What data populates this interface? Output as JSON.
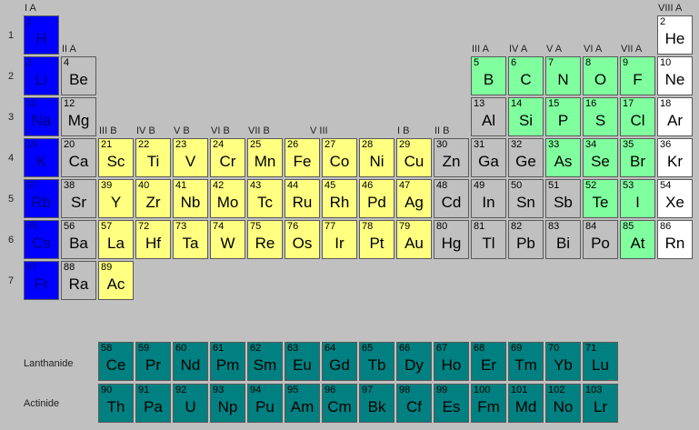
{
  "colors": {
    "s": "#0000ff",
    "nm": "#80ff9f",
    "tm": "#ffff80",
    "pm": "#c0c0c0",
    "ng": "#ffffff",
    "ln": "#008080",
    "gray": "#c0c0c0"
  },
  "groups": [
    {
      "label": "I A",
      "col": 1
    },
    {
      "label": "II A",
      "col": 2
    },
    {
      "label": "III B",
      "col": 3
    },
    {
      "label": "IV B",
      "col": 4
    },
    {
      "label": "V B",
      "col": 5
    },
    {
      "label": "VI B",
      "col": 6
    },
    {
      "label": "VII B",
      "col": 7
    },
    {
      "label": "V III",
      "col": 9
    },
    {
      "label": "I B",
      "col": 11
    },
    {
      "label": "II B",
      "col": 12
    },
    {
      "label": "III A",
      "col": 13
    },
    {
      "label": "IV A",
      "col": 14
    },
    {
      "label": "V A",
      "col": 15
    },
    {
      "label": "VI A",
      "col": 16
    },
    {
      "label": "VII A",
      "col": 17
    },
    {
      "label": "VIII A",
      "col": 18
    }
  ],
  "periods": [
    "1",
    "2",
    "3",
    "4",
    "5",
    "6",
    "7"
  ],
  "series_labels": {
    "lanthanide": "Lanthanide",
    "actinide": "Actinide"
  },
  "elements": [
    {
      "n": "1",
      "s": "H",
      "r": 1,
      "c": 1,
      "t": "s"
    },
    {
      "n": "2",
      "s": "He",
      "r": 1,
      "c": 18,
      "t": "ng"
    },
    {
      "n": "3",
      "s": "Li",
      "r": 2,
      "c": 1,
      "t": "s"
    },
    {
      "n": "4",
      "s": "Be",
      "r": 2,
      "c": 2,
      "t": "gray"
    },
    {
      "n": "5",
      "s": "B",
      "r": 2,
      "c": 13,
      "t": "nm"
    },
    {
      "n": "6",
      "s": "C",
      "r": 2,
      "c": 14,
      "t": "nm"
    },
    {
      "n": "7",
      "s": "N",
      "r": 2,
      "c": 15,
      "t": "nm"
    },
    {
      "n": "8",
      "s": "O",
      "r": 2,
      "c": 16,
      "t": "nm"
    },
    {
      "n": "9",
      "s": "F",
      "r": 2,
      "c": 17,
      "t": "nm"
    },
    {
      "n": "10",
      "s": "Ne",
      "r": 2,
      "c": 18,
      "t": "ng"
    },
    {
      "n": "11",
      "s": "Na",
      "r": 3,
      "c": 1,
      "t": "s"
    },
    {
      "n": "12",
      "s": "Mg",
      "r": 3,
      "c": 2,
      "t": "gray"
    },
    {
      "n": "13",
      "s": "Al",
      "r": 3,
      "c": 13,
      "t": "pm"
    },
    {
      "n": "14",
      "s": "Si",
      "r": 3,
      "c": 14,
      "t": "nm"
    },
    {
      "n": "15",
      "s": "P",
      "r": 3,
      "c": 15,
      "t": "nm"
    },
    {
      "n": "16",
      "s": "S",
      "r": 3,
      "c": 16,
      "t": "nm"
    },
    {
      "n": "17",
      "s": "Cl",
      "r": 3,
      "c": 17,
      "t": "nm"
    },
    {
      "n": "18",
      "s": "Ar",
      "r": 3,
      "c": 18,
      "t": "ng"
    },
    {
      "n": "19",
      "s": "K",
      "r": 4,
      "c": 1,
      "t": "s"
    },
    {
      "n": "20",
      "s": "Ca",
      "r": 4,
      "c": 2,
      "t": "gray"
    },
    {
      "n": "21",
      "s": "Sc",
      "r": 4,
      "c": 3,
      "t": "tm"
    },
    {
      "n": "22",
      "s": "Ti",
      "r": 4,
      "c": 4,
      "t": "tm"
    },
    {
      "n": "23",
      "s": "V",
      "r": 4,
      "c": 5,
      "t": "tm"
    },
    {
      "n": "24",
      "s": "Cr",
      "r": 4,
      "c": 6,
      "t": "tm"
    },
    {
      "n": "25",
      "s": "Mn",
      "r": 4,
      "c": 7,
      "t": "tm"
    },
    {
      "n": "26",
      "s": "Fe",
      "r": 4,
      "c": 8,
      "t": "tm"
    },
    {
      "n": "27",
      "s": "Co",
      "r": 4,
      "c": 9,
      "t": "tm"
    },
    {
      "n": "28",
      "s": "Ni",
      "r": 4,
      "c": 10,
      "t": "tm"
    },
    {
      "n": "29",
      "s": "Cu",
      "r": 4,
      "c": 11,
      "t": "tm"
    },
    {
      "n": "30",
      "s": "Zn",
      "r": 4,
      "c": 12,
      "t": "pm"
    },
    {
      "n": "31",
      "s": "Ga",
      "r": 4,
      "c": 13,
      "t": "pm"
    },
    {
      "n": "32",
      "s": "Ge",
      "r": 4,
      "c": 14,
      "t": "pm"
    },
    {
      "n": "33",
      "s": "As",
      "r": 4,
      "c": 15,
      "t": "nm"
    },
    {
      "n": "34",
      "s": "Se",
      "r": 4,
      "c": 16,
      "t": "nm"
    },
    {
      "n": "35",
      "s": "Br",
      "r": 4,
      "c": 17,
      "t": "nm"
    },
    {
      "n": "36",
      "s": "Kr",
      "r": 4,
      "c": 18,
      "t": "ng"
    },
    {
      "n": "37",
      "s": "Rb",
      "r": 5,
      "c": 1,
      "t": "s"
    },
    {
      "n": "38",
      "s": "Sr",
      "r": 5,
      "c": 2,
      "t": "gray"
    },
    {
      "n": "39",
      "s": "Y",
      "r": 5,
      "c": 3,
      "t": "tm"
    },
    {
      "n": "40",
      "s": "Zr",
      "r": 5,
      "c": 4,
      "t": "tm"
    },
    {
      "n": "41",
      "s": "Nb",
      "r": 5,
      "c": 5,
      "t": "tm"
    },
    {
      "n": "42",
      "s": "Mo",
      "r": 5,
      "c": 6,
      "t": "tm"
    },
    {
      "n": "43",
      "s": "Tc",
      "r": 5,
      "c": 7,
      "t": "tm"
    },
    {
      "n": "44",
      "s": "Ru",
      "r": 5,
      "c": 8,
      "t": "tm"
    },
    {
      "n": "45",
      "s": "Rh",
      "r": 5,
      "c": 9,
      "t": "tm"
    },
    {
      "n": "46",
      "s": "Pd",
      "r": 5,
      "c": 10,
      "t": "tm"
    },
    {
      "n": "47",
      "s": "Ag",
      "r": 5,
      "c": 11,
      "t": "tm"
    },
    {
      "n": "48",
      "s": "Cd",
      "r": 5,
      "c": 12,
      "t": "pm"
    },
    {
      "n": "49",
      "s": "In",
      "r": 5,
      "c": 13,
      "t": "pm"
    },
    {
      "n": "50",
      "s": "Sn",
      "r": 5,
      "c": 14,
      "t": "pm"
    },
    {
      "n": "51",
      "s": "Sb",
      "r": 5,
      "c": 15,
      "t": "pm"
    },
    {
      "n": "52",
      "s": "Te",
      "r": 5,
      "c": 16,
      "t": "nm"
    },
    {
      "n": "53",
      "s": "I",
      "r": 5,
      "c": 17,
      "t": "nm"
    },
    {
      "n": "54",
      "s": "Xe",
      "r": 5,
      "c": 18,
      "t": "ng"
    },
    {
      "n": "55",
      "s": "Cs",
      "r": 6,
      "c": 1,
      "t": "s"
    },
    {
      "n": "56",
      "s": "Ba",
      "r": 6,
      "c": 2,
      "t": "gray"
    },
    {
      "n": "57",
      "s": "La",
      "r": 6,
      "c": 3,
      "t": "tm"
    },
    {
      "n": "72",
      "s": "Hf",
      "r": 6,
      "c": 4,
      "t": "tm"
    },
    {
      "n": "73",
      "s": "Ta",
      "r": 6,
      "c": 5,
      "t": "tm"
    },
    {
      "n": "74",
      "s": "W",
      "r": 6,
      "c": 6,
      "t": "tm"
    },
    {
      "n": "75",
      "s": "Re",
      "r": 6,
      "c": 7,
      "t": "tm"
    },
    {
      "n": "76",
      "s": "Os",
      "r": 6,
      "c": 8,
      "t": "tm"
    },
    {
      "n": "77",
      "s": "Ir",
      "r": 6,
      "c": 9,
      "t": "tm"
    },
    {
      "n": "78",
      "s": "Pt",
      "r": 6,
      "c": 10,
      "t": "tm"
    },
    {
      "n": "79",
      "s": "Au",
      "r": 6,
      "c": 11,
      "t": "tm"
    },
    {
      "n": "80",
      "s": "Hg",
      "r": 6,
      "c": 12,
      "t": "pm"
    },
    {
      "n": "81",
      "s": "Tl",
      "r": 6,
      "c": 13,
      "t": "pm"
    },
    {
      "n": "82",
      "s": "Pb",
      "r": 6,
      "c": 14,
      "t": "pm"
    },
    {
      "n": "83",
      "s": "Bi",
      "r": 6,
      "c": 15,
      "t": "pm"
    },
    {
      "n": "84",
      "s": "Po",
      "r": 6,
      "c": 16,
      "t": "pm"
    },
    {
      "n": "85",
      "s": "At",
      "r": 6,
      "c": 17,
      "t": "nm"
    },
    {
      "n": "86",
      "s": "Rn",
      "r": 6,
      "c": 18,
      "t": "ng"
    },
    {
      "n": "87",
      "s": "Fr",
      "r": 7,
      "c": 1,
      "t": "s"
    },
    {
      "n": "88",
      "s": "Ra",
      "r": 7,
      "c": 2,
      "t": "gray"
    },
    {
      "n": "89",
      "s": "Ac",
      "r": 7,
      "c": 3,
      "t": "tm"
    },
    {
      "n": "58",
      "s": "Ce",
      "r": 9,
      "c": 3,
      "t": "ln"
    },
    {
      "n": "59",
      "s": "Pr",
      "r": 9,
      "c": 4,
      "t": "ln"
    },
    {
      "n": "60",
      "s": "Nd",
      "r": 9,
      "c": 5,
      "t": "ln"
    },
    {
      "n": "61",
      "s": "Pm",
      "r": 9,
      "c": 6,
      "t": "ln"
    },
    {
      "n": "62",
      "s": "Sm",
      "r": 9,
      "c": 7,
      "t": "ln"
    },
    {
      "n": "63",
      "s": "Eu",
      "r": 9,
      "c": 8,
      "t": "ln"
    },
    {
      "n": "64",
      "s": "Gd",
      "r": 9,
      "c": 9,
      "t": "ln"
    },
    {
      "n": "65",
      "s": "Tb",
      "r": 9,
      "c": 10,
      "t": "ln"
    },
    {
      "n": "66",
      "s": "Dy",
      "r": 9,
      "c": 11,
      "t": "ln"
    },
    {
      "n": "67",
      "s": "Ho",
      "r": 9,
      "c": 12,
      "t": "ln"
    },
    {
      "n": "68",
      "s": "Er",
      "r": 9,
      "c": 13,
      "t": "ln"
    },
    {
      "n": "69",
      "s": "Tm",
      "r": 9,
      "c": 14,
      "t": "ln"
    },
    {
      "n": "70",
      "s": "Yb",
      "r": 9,
      "c": 15,
      "t": "ln"
    },
    {
      "n": "71",
      "s": "Lu",
      "r": 9,
      "c": 16,
      "t": "ln"
    },
    {
      "n": "90",
      "s": "Th",
      "r": 10,
      "c": 3,
      "t": "ln"
    },
    {
      "n": "91",
      "s": "Pa",
      "r": 10,
      "c": 4,
      "t": "ln"
    },
    {
      "n": "92",
      "s": "U",
      "r": 10,
      "c": 5,
      "t": "ln"
    },
    {
      "n": "93",
      "s": "Np",
      "r": 10,
      "c": 6,
      "t": "ln"
    },
    {
      "n": "94",
      "s": "Pu",
      "r": 10,
      "c": 7,
      "t": "ln"
    },
    {
      "n": "95",
      "s": "Am",
      "r": 10,
      "c": 8,
      "t": "ln"
    },
    {
      "n": "96",
      "s": "Cm",
      "r": 10,
      "c": 9,
      "t": "ln"
    },
    {
      "n": "97",
      "s": "Bk",
      "r": 10,
      "c": 10,
      "t": "ln"
    },
    {
      "n": "98",
      "s": "Cf",
      "r": 10,
      "c": 11,
      "t": "ln"
    },
    {
      "n": "99",
      "s": "Es",
      "r": 10,
      "c": 12,
      "t": "ln"
    },
    {
      "n": "100",
      "s": "Fm",
      "r": 10,
      "c": 13,
      "t": "ln"
    },
    {
      "n": "101",
      "s": "Md",
      "r": 10,
      "c": 14,
      "t": "ln"
    },
    {
      "n": "102",
      "s": "No",
      "r": 10,
      "c": 15,
      "t": "ln"
    },
    {
      "n": "103",
      "s": "Lr",
      "r": 10,
      "c": 16,
      "t": "ln"
    }
  ]
}
